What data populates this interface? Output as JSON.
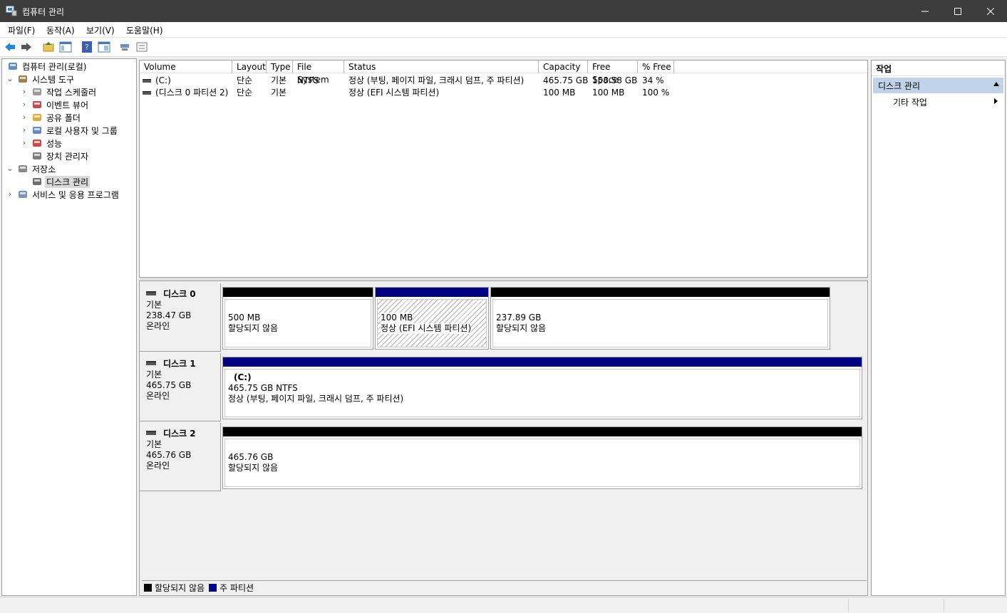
{
  "window": {
    "title": "컴퓨터 관리"
  },
  "menu": [
    "파일(F)",
    "동작(A)",
    "보기(V)",
    "도움말(H)"
  ],
  "toolbar": [
    "back-icon",
    "forward-icon",
    "up-folder-icon",
    "show-hide-tree-icon",
    "help-icon",
    "properties-icon",
    "connect-icon",
    "view-icon"
  ],
  "tree": [
    {
      "label": "컴퓨터 관리(로컬)",
      "icon": "computer-management-icon",
      "level": 0,
      "expander": ""
    },
    {
      "label": "시스템 도구",
      "icon": "system-tools-icon",
      "level": 1,
      "expander": "v"
    },
    {
      "label": "작업 스케줄러",
      "icon": "clock-icon",
      "level": 2,
      "expander": ">"
    },
    {
      "label": "이벤트 뷰어",
      "icon": "event-viewer-icon",
      "level": 2,
      "expander": ">"
    },
    {
      "label": "공유 폴더",
      "icon": "shared-folder-icon",
      "level": 2,
      "expander": ">"
    },
    {
      "label": "로컬 사용자 및 그룹",
      "icon": "users-icon",
      "level": 2,
      "expander": ">"
    },
    {
      "label": "성능",
      "icon": "performance-icon",
      "level": 2,
      "expander": ">"
    },
    {
      "label": "장치 관리자",
      "icon": "device-manager-icon",
      "level": 2,
      "expander": ""
    },
    {
      "label": "저장소",
      "icon": "storage-icon",
      "level": 1,
      "expander": "v"
    },
    {
      "label": "디스크 관리",
      "icon": "disk-management-icon",
      "level": 2,
      "expander": "",
      "selected": true
    },
    {
      "label": "서비스 및 응용 프로그램",
      "icon": "services-icon",
      "level": 1,
      "expander": ">"
    }
  ],
  "volumes": {
    "headers": [
      "Volume",
      "Layout",
      "Type",
      "File System",
      "Status",
      "Capacity",
      "Free Space",
      "% Free"
    ],
    "rows": [
      [
        "(C:)",
        "단순",
        "기본",
        "NTFS",
        "정상 (부팅, 페이지 파일, 크래시 덤프, 주 파티션)",
        "465.75 GB",
        "158.58 GB",
        "34 %"
      ],
      [
        "(디스크 0 파티션 2)",
        "단순",
        "기본",
        "",
        "정상 (EFI 시스템 파티션)",
        "100 MB",
        "100 MB",
        "100 %"
      ]
    ]
  },
  "disks": [
    {
      "name": "디스크 0",
      "type": "기본",
      "size": "238.47 GB",
      "state": "온라인",
      "partitions": [
        {
          "title": "",
          "line1": "500 MB",
          "line2": "할당되지 않음",
          "kind": "unallocated",
          "share": 0.25
        },
        {
          "title": "",
          "line1": "100 MB",
          "line2": "정상 (EFI 시스템 파티션)",
          "kind": "primary-hatched",
          "share": 0.19
        },
        {
          "title": "",
          "line1": "237.89 GB",
          "line2": "할당되지 않음",
          "kind": "unallocated",
          "share": 0.56
        }
      ]
    },
    {
      "name": "디스크 1",
      "type": "기본",
      "size": "465.75 GB",
      "state": "온라인",
      "partitions": [
        {
          "title": "(C:)",
          "line1": "465.75 GB NTFS",
          "line2": "정상 (부팅, 페이지 파일, 크래시 덤프, 주 파티션)",
          "kind": "primary",
          "share": 1
        }
      ]
    },
    {
      "name": "디스크 2",
      "type": "기본",
      "size": "465.76 GB",
      "state": "온라인",
      "partitions": [
        {
          "title": "",
          "line1": "465.76 GB",
          "line2": "할당되지 않음",
          "kind": "unallocated",
          "share": 1
        }
      ]
    }
  ],
  "legend": [
    {
      "label": "할당되지 않음",
      "color": "#000000"
    },
    {
      "label": "주 파티션",
      "color": "#00008b"
    }
  ],
  "actions": {
    "header": "작업",
    "section": "디스크 관리",
    "item": "기타 작업"
  },
  "colors": {
    "titlebar": "#3c3c3c",
    "primary": "#000080",
    "unallocated": "#000000",
    "selection": "#c0d3e8"
  }
}
